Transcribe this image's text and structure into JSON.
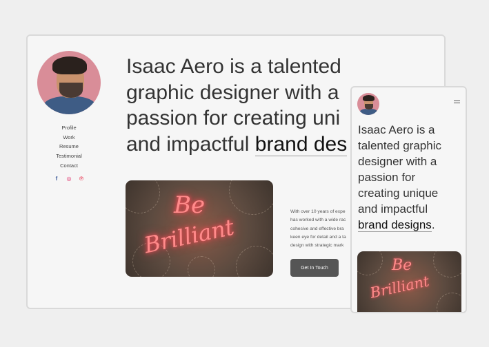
{
  "colors": {
    "accent": "#555555",
    "background": "#efefef",
    "card": "#f6f6f6",
    "neon": "#ff8a8a"
  },
  "profile": {
    "avatar_icon": "profile-photo"
  },
  "nav": {
    "items": [
      {
        "label": "Profile"
      },
      {
        "label": "Work"
      },
      {
        "label": "Resume"
      },
      {
        "label": "Testimonial"
      },
      {
        "label": "Contact"
      }
    ]
  },
  "socials": [
    {
      "icon": "facebook-icon",
      "glyph": "f",
      "color": "#3b5998"
    },
    {
      "icon": "instagram-icon",
      "glyph": "◎",
      "color": "#e1306c"
    },
    {
      "icon": "pinterest-icon",
      "glyph": "℗",
      "color": "#e60023"
    }
  ],
  "hero": {
    "line1": "Isaac Aero is a talented",
    "line2": "graphic designer with a",
    "line3": "passion for creating uni",
    "line4_plain": "and impactful ",
    "line4_em": "brand des"
  },
  "image": {
    "line1": "Be",
    "line2": "Brilliant"
  },
  "about": {
    "line1": "With over 10 years of expe",
    "line2": "has worked with a wide rac",
    "line3": "cohesive and effective bra",
    "line4": "keen eye for detail and a ta",
    "line5": "design with strategic mark"
  },
  "cta": {
    "label": "Get In Touch"
  },
  "mobile": {
    "hero_lines": [
      "Isaac Aero is a",
      "talented graphic",
      "designer with a",
      "passion for",
      "creating unique",
      "and impactful"
    ],
    "hero_em": "brand designs",
    "hero_end": ".",
    "image": {
      "line1": "Be",
      "line2": "Brilliant"
    }
  }
}
